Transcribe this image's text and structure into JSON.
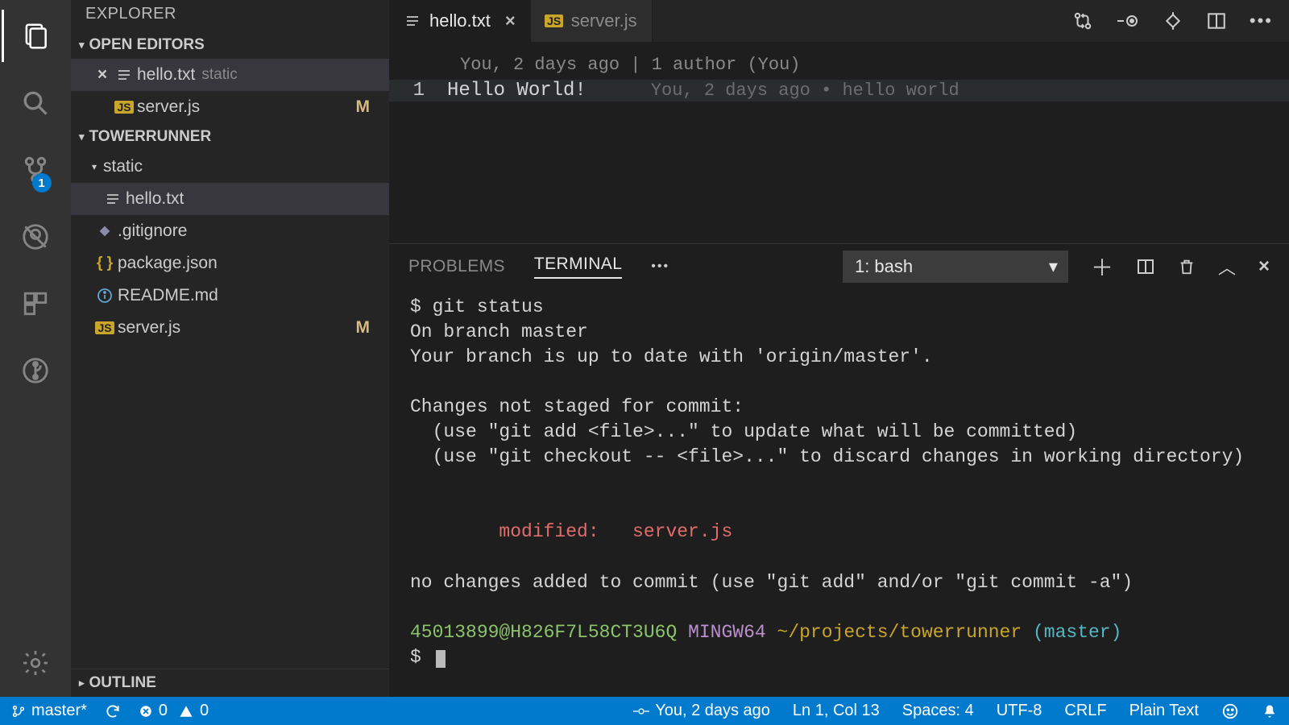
{
  "sidebar": {
    "title": "EXPLORER",
    "openEditorsLabel": "OPEN EDITORS",
    "openEditors": [
      {
        "name": "hello.txt",
        "suffix": "static",
        "icon": "lines",
        "selected": true,
        "close": true
      },
      {
        "name": "server.js",
        "suffix": "",
        "icon": "js",
        "modified": "M"
      }
    ],
    "projectLabel": "TOWERRUNNER",
    "tree": [
      {
        "name": "static",
        "icon": "folder-open",
        "indent": 1,
        "folder": true
      },
      {
        "name": "hello.txt",
        "icon": "lines",
        "indent": 2,
        "selected": true
      },
      {
        "name": ".gitignore",
        "icon": "diamond",
        "indent": 1
      },
      {
        "name": "package.json",
        "icon": "braces",
        "indent": 1
      },
      {
        "name": "README.md",
        "icon": "info",
        "indent": 1
      },
      {
        "name": "server.js",
        "icon": "js",
        "indent": 1,
        "modified": "M"
      }
    ],
    "outlineLabel": "OUTLINE"
  },
  "scmBadge": "1",
  "tabs": [
    {
      "name": "hello.txt",
      "icon": "lines",
      "active": true,
      "close": true
    },
    {
      "name": "server.js",
      "icon": "js",
      "active": false
    }
  ],
  "editor": {
    "codelens": "You, 2 days ago | 1 author (You)",
    "lineNo": "1",
    "code": "Hello World!",
    "blame": "You, 2 days ago • hello world"
  },
  "panel": {
    "tabs": {
      "problems": "PROBLEMS",
      "terminal": "TERMINAL"
    },
    "termSelect": "1: bash",
    "lines": {
      "l1": "$ git status",
      "l2": "On branch master",
      "l3": "Your branch is up to date with 'origin/master'.",
      "l4": "Changes not staged for commit:",
      "l5": "  (use \"git add <file>...\" to update what will be committed)",
      "l6": "  (use \"git checkout -- <file>...\" to discard changes in working directory)",
      "l7": "        modified:   server.js",
      "l8": "no changes added to commit (use \"git add\" and/or \"git commit -a\")",
      "p_user": "45013899@H826F7L58CT3U6Q",
      "p_sys": "MINGW64",
      "p_path": "~/projects/towerrunner",
      "p_branch": "(master)",
      "l10": "$ "
    }
  },
  "status": {
    "branch": "master*",
    "errors": "0",
    "warnings": "0",
    "blame": "You, 2 days ago",
    "pos": "Ln 1, Col 13",
    "spaces": "Spaces: 4",
    "encoding": "UTF-8",
    "eol": "CRLF",
    "lang": "Plain Text"
  }
}
